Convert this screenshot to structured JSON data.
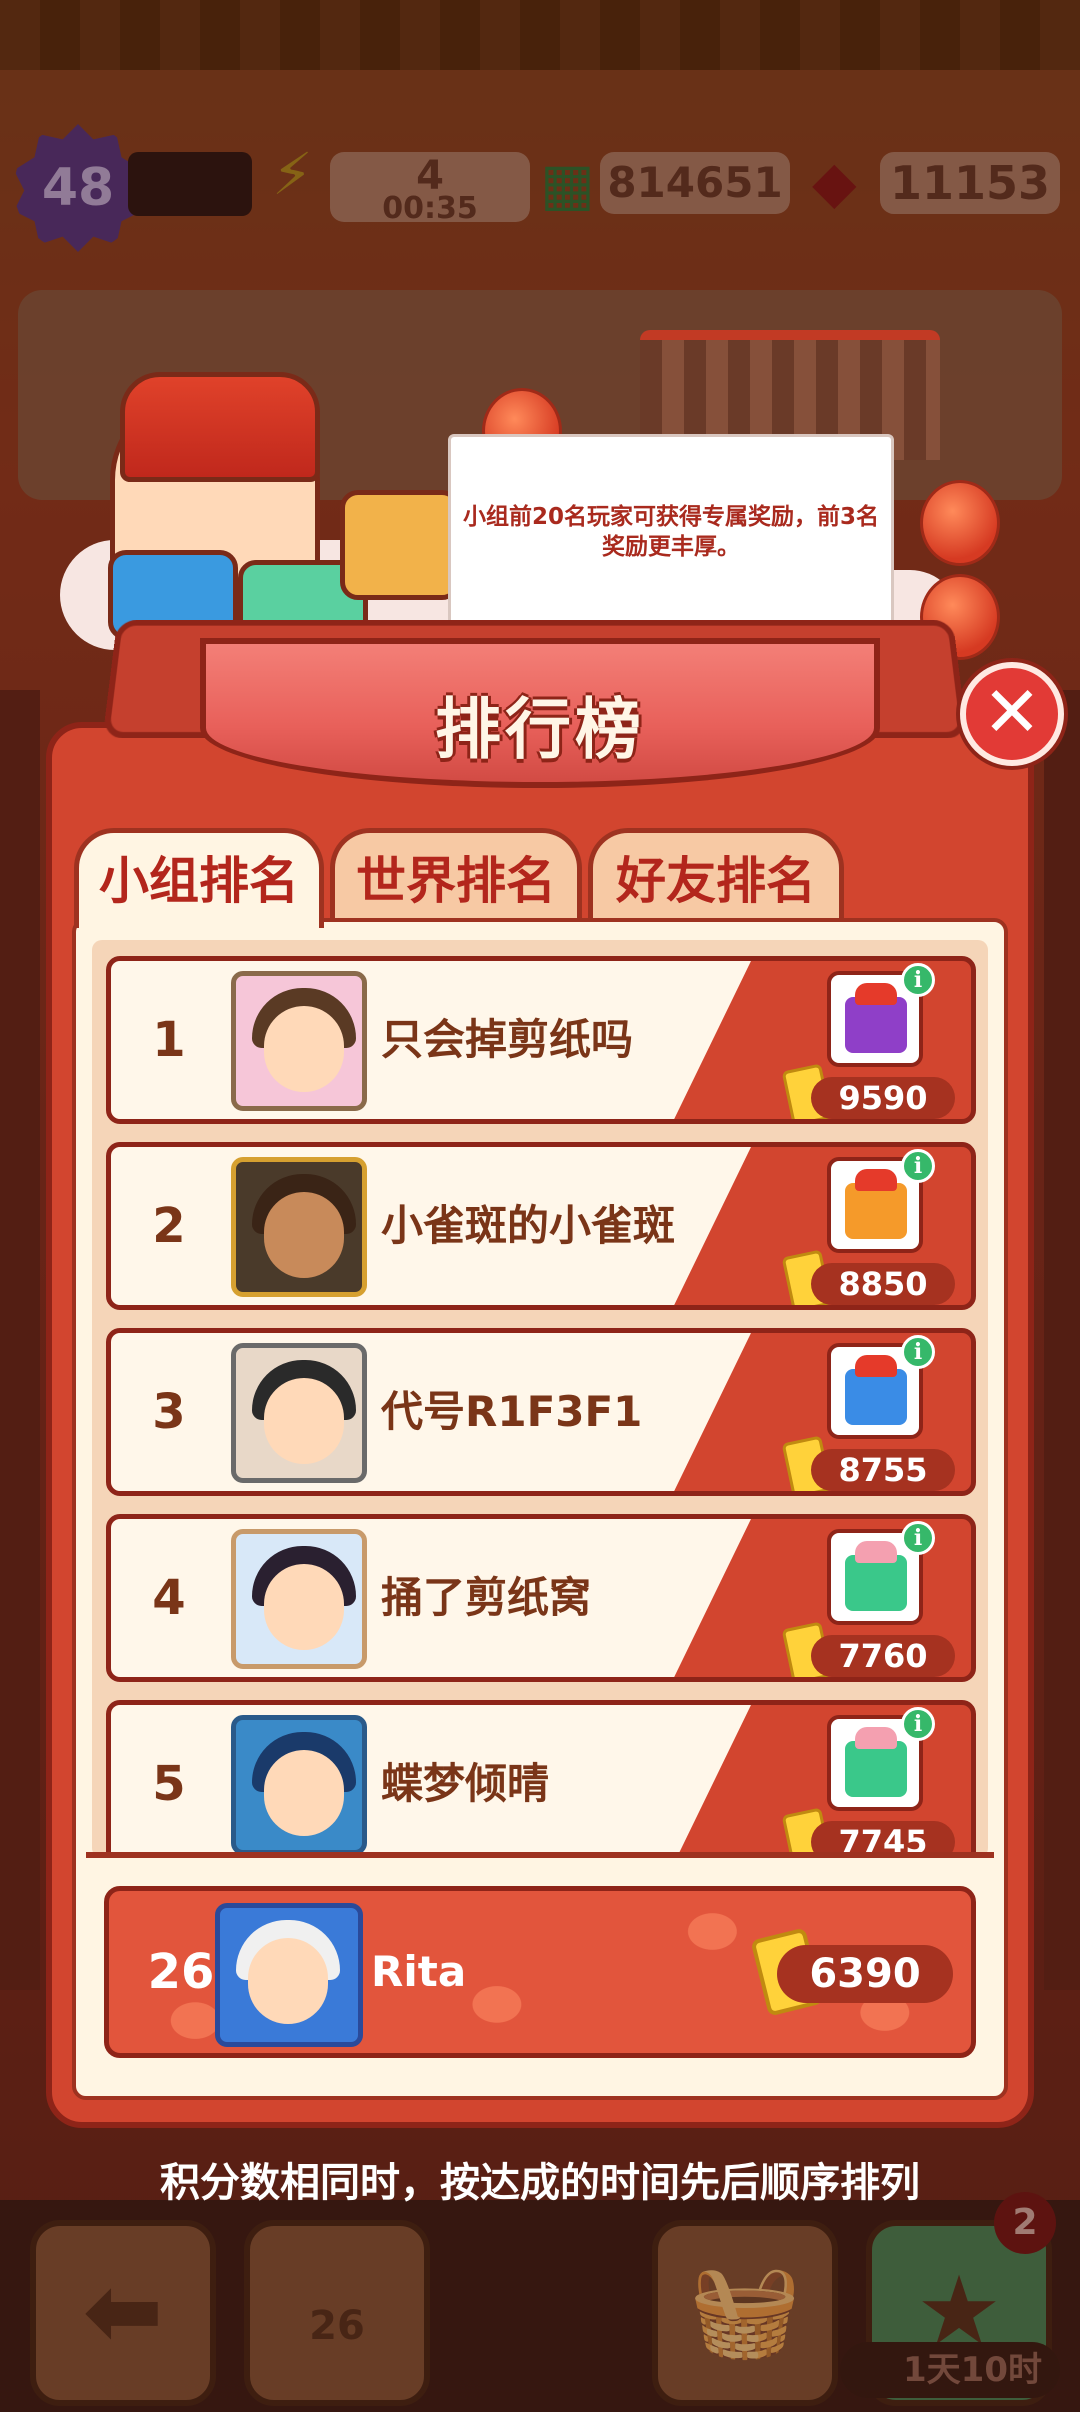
{
  "hud": {
    "level": "48",
    "energy": "4",
    "energy_timer": "00:35",
    "cash": "814651",
    "gems": "11153"
  },
  "notice": "小组前20名玩家可获得专属奖励，前3名奖励更丰厚。",
  "title": "排行榜",
  "tabs": [
    {
      "label": "小组排名",
      "active": true
    },
    {
      "label": "世界排名",
      "active": false
    },
    {
      "label": "好友排名",
      "active": false
    }
  ],
  "rows": [
    {
      "rank": "1",
      "name": "只会掉剪纸吗",
      "score": "9590",
      "gift_color": "#8f3fc8"
    },
    {
      "rank": "2",
      "name": "小雀斑的小雀斑",
      "score": "8850",
      "gift_color": "#f59a2a"
    },
    {
      "rank": "3",
      "name": "代号R1F3F1",
      "score": "8755",
      "gift_color": "#3a8ce6"
    },
    {
      "rank": "4",
      "name": "捅了剪纸窝",
      "score": "7760",
      "gift_color": "#3ac88a"
    },
    {
      "rank": "5",
      "name": "蝶梦倾晴",
      "score": "7745",
      "gift_color": "#3ac88a"
    }
  ],
  "self": {
    "rank": "26",
    "name": "Rita",
    "score": "6390"
  },
  "footer": "积分数相同时，按达成的时间先后顺序排列",
  "bottom": {
    "trophy_count": "26",
    "badge": "2",
    "timer": "1天10时"
  },
  "colors": {
    "panel": "#d2452f",
    "panel_border": "#8e2418",
    "cream": "#fff5e3",
    "text_brown": "#7a3518",
    "accent_red": "#b3261c"
  }
}
